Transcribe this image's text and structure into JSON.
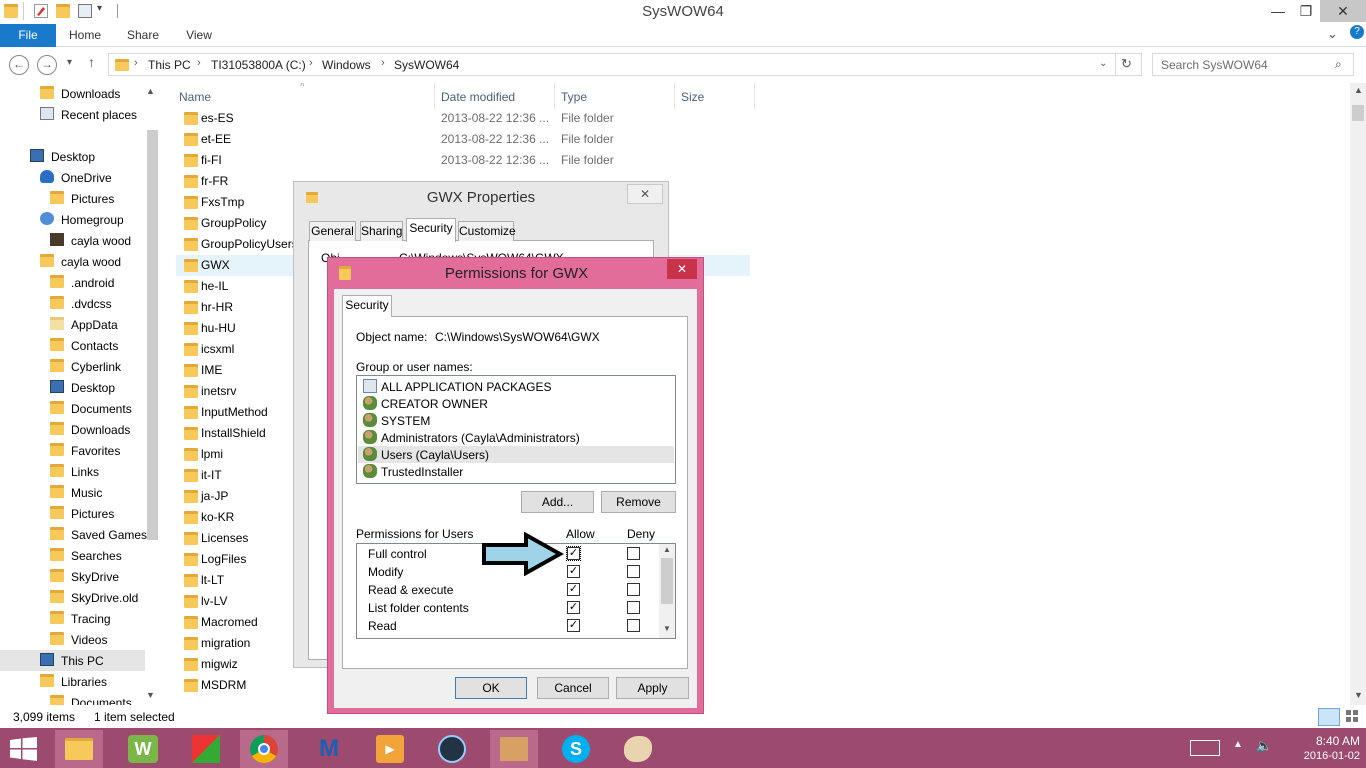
{
  "window": {
    "title": "SysWOW64",
    "minimize": "—",
    "maximize": "❐",
    "close": "✕"
  },
  "ribbon": {
    "tabs": [
      "File",
      "Home",
      "Share",
      "View"
    ],
    "expand": "⌄",
    "help": "?"
  },
  "address": {
    "crumbs": [
      "This PC",
      "TI31053800A (C:)",
      "Windows",
      "SysWOW64"
    ],
    "search_placeholder": "Search SysWOW64"
  },
  "nav": {
    "items": [
      {
        "label": "Downloads",
        "indent": 1
      },
      {
        "label": "Recent places",
        "indent": 1
      },
      {
        "label": "",
        "indent": 0
      },
      {
        "label": "Desktop",
        "indent": 0
      },
      {
        "label": "OneDrive",
        "indent": 1
      },
      {
        "label": "Pictures",
        "indent": 2
      },
      {
        "label": "Homegroup",
        "indent": 1
      },
      {
        "label": "cayla wood",
        "indent": 2
      },
      {
        "label": "cayla wood",
        "indent": 1
      },
      {
        "label": ".android",
        "indent": 2
      },
      {
        "label": ".dvdcss",
        "indent": 2
      },
      {
        "label": "AppData",
        "indent": 2
      },
      {
        "label": "Contacts",
        "indent": 2
      },
      {
        "label": "Cyberlink",
        "indent": 2
      },
      {
        "label": "Desktop",
        "indent": 2
      },
      {
        "label": "Documents",
        "indent": 2
      },
      {
        "label": "Downloads",
        "indent": 2
      },
      {
        "label": "Favorites",
        "indent": 2
      },
      {
        "label": "Links",
        "indent": 2
      },
      {
        "label": "Music",
        "indent": 2
      },
      {
        "label": "Pictures",
        "indent": 2
      },
      {
        "label": "Saved Games",
        "indent": 2
      },
      {
        "label": "Searches",
        "indent": 2
      },
      {
        "label": "SkyDrive",
        "indent": 2
      },
      {
        "label": "SkyDrive.old",
        "indent": 2
      },
      {
        "label": "Tracing",
        "indent": 2
      },
      {
        "label": "Videos",
        "indent": 2
      },
      {
        "label": "This PC",
        "indent": 1
      },
      {
        "label": "Libraries",
        "indent": 1
      },
      {
        "label": "Documents",
        "indent": 2
      }
    ]
  },
  "filelist": {
    "headers": [
      "Name",
      "Date modified",
      "Type",
      "Size"
    ],
    "rows": [
      {
        "name": "es-ES",
        "date": "2013-08-22 12:36 ...",
        "type": "File folder"
      },
      {
        "name": "et-EE",
        "date": "2013-08-22 12:36 ...",
        "type": "File folder"
      },
      {
        "name": "fi-FI",
        "date": "2013-08-22 12:36 ...",
        "type": "File folder"
      },
      {
        "name": "fr-FR",
        "date": "",
        "type": ""
      },
      {
        "name": "FxsTmp",
        "date": "",
        "type": ""
      },
      {
        "name": "GroupPolicy",
        "date": "",
        "type": ""
      },
      {
        "name": "GroupPolicyUsers",
        "date": "",
        "type": ""
      },
      {
        "name": "GWX",
        "date": "",
        "type": ""
      },
      {
        "name": "he-IL",
        "date": "",
        "type": ""
      },
      {
        "name": "hr-HR",
        "date": "",
        "type": ""
      },
      {
        "name": "hu-HU",
        "date": "",
        "type": ""
      },
      {
        "name": "icsxml",
        "date": "",
        "type": ""
      },
      {
        "name": "IME",
        "date": "",
        "type": ""
      },
      {
        "name": "inetsrv",
        "date": "",
        "type": ""
      },
      {
        "name": "InputMethod",
        "date": "",
        "type": ""
      },
      {
        "name": "InstallShield",
        "date": "",
        "type": ""
      },
      {
        "name": "lpmi",
        "date": "",
        "type": ""
      },
      {
        "name": "it-IT",
        "date": "",
        "type": ""
      },
      {
        "name": "ja-JP",
        "date": "",
        "type": ""
      },
      {
        "name": "ko-KR",
        "date": "",
        "type": ""
      },
      {
        "name": "Licenses",
        "date": "",
        "type": ""
      },
      {
        "name": "LogFiles",
        "date": "",
        "type": ""
      },
      {
        "name": "lt-LT",
        "date": "",
        "type": ""
      },
      {
        "name": "lv-LV",
        "date": "",
        "type": ""
      },
      {
        "name": "Macromed",
        "date": "",
        "type": ""
      },
      {
        "name": "migration",
        "date": "",
        "type": ""
      },
      {
        "name": "migwiz",
        "date": "",
        "type": ""
      },
      {
        "name": "MSDRM",
        "date": "",
        "type": ""
      }
    ]
  },
  "status": {
    "items": "3,099 items",
    "selected": "1 item selected"
  },
  "gwx_props": {
    "title": "GWX Properties",
    "tabs": [
      "General",
      "Sharing",
      "Security",
      "Customize"
    ],
    "object_prefix": "Obj",
    "object_value": "C:\\Windows\\SysWOW64\\GWX"
  },
  "perm": {
    "title": "Permissions for GWX",
    "tab": "Security",
    "object_label": "Object name:",
    "object_value": "C:\\Windows\\SysWOW64\\GWX",
    "group_label": "Group or user names:",
    "users": [
      "ALL APPLICATION PACKAGES",
      "CREATOR OWNER",
      "SYSTEM",
      "Administrators (Cayla\\Administrators)",
      "Users (Cayla\\Users)",
      "TrustedInstaller"
    ],
    "add_button": "Add...",
    "remove_button": "Remove",
    "perm_label": "Permissions for Users",
    "allow_label": "Allow",
    "deny_label": "Deny",
    "permissions": [
      {
        "name": "Full control",
        "allow": true,
        "deny": false
      },
      {
        "name": "Modify",
        "allow": true,
        "deny": false
      },
      {
        "name": "Read & execute",
        "allow": true,
        "deny": false
      },
      {
        "name": "List folder contents",
        "allow": true,
        "deny": false
      },
      {
        "name": "Read",
        "allow": true,
        "deny": false
      }
    ],
    "ok_button": "OK",
    "cancel_button": "Cancel",
    "apply_button": "Apply",
    "close": "✕"
  },
  "taskbar": {
    "time": "8:40 AM",
    "date": "2016-01-02"
  },
  "colors": {
    "accent": "#1979ca",
    "taskbar": "#9c4a6d",
    "dialog_frame": "#e36d9a",
    "arrow": "#9fd3e8"
  }
}
